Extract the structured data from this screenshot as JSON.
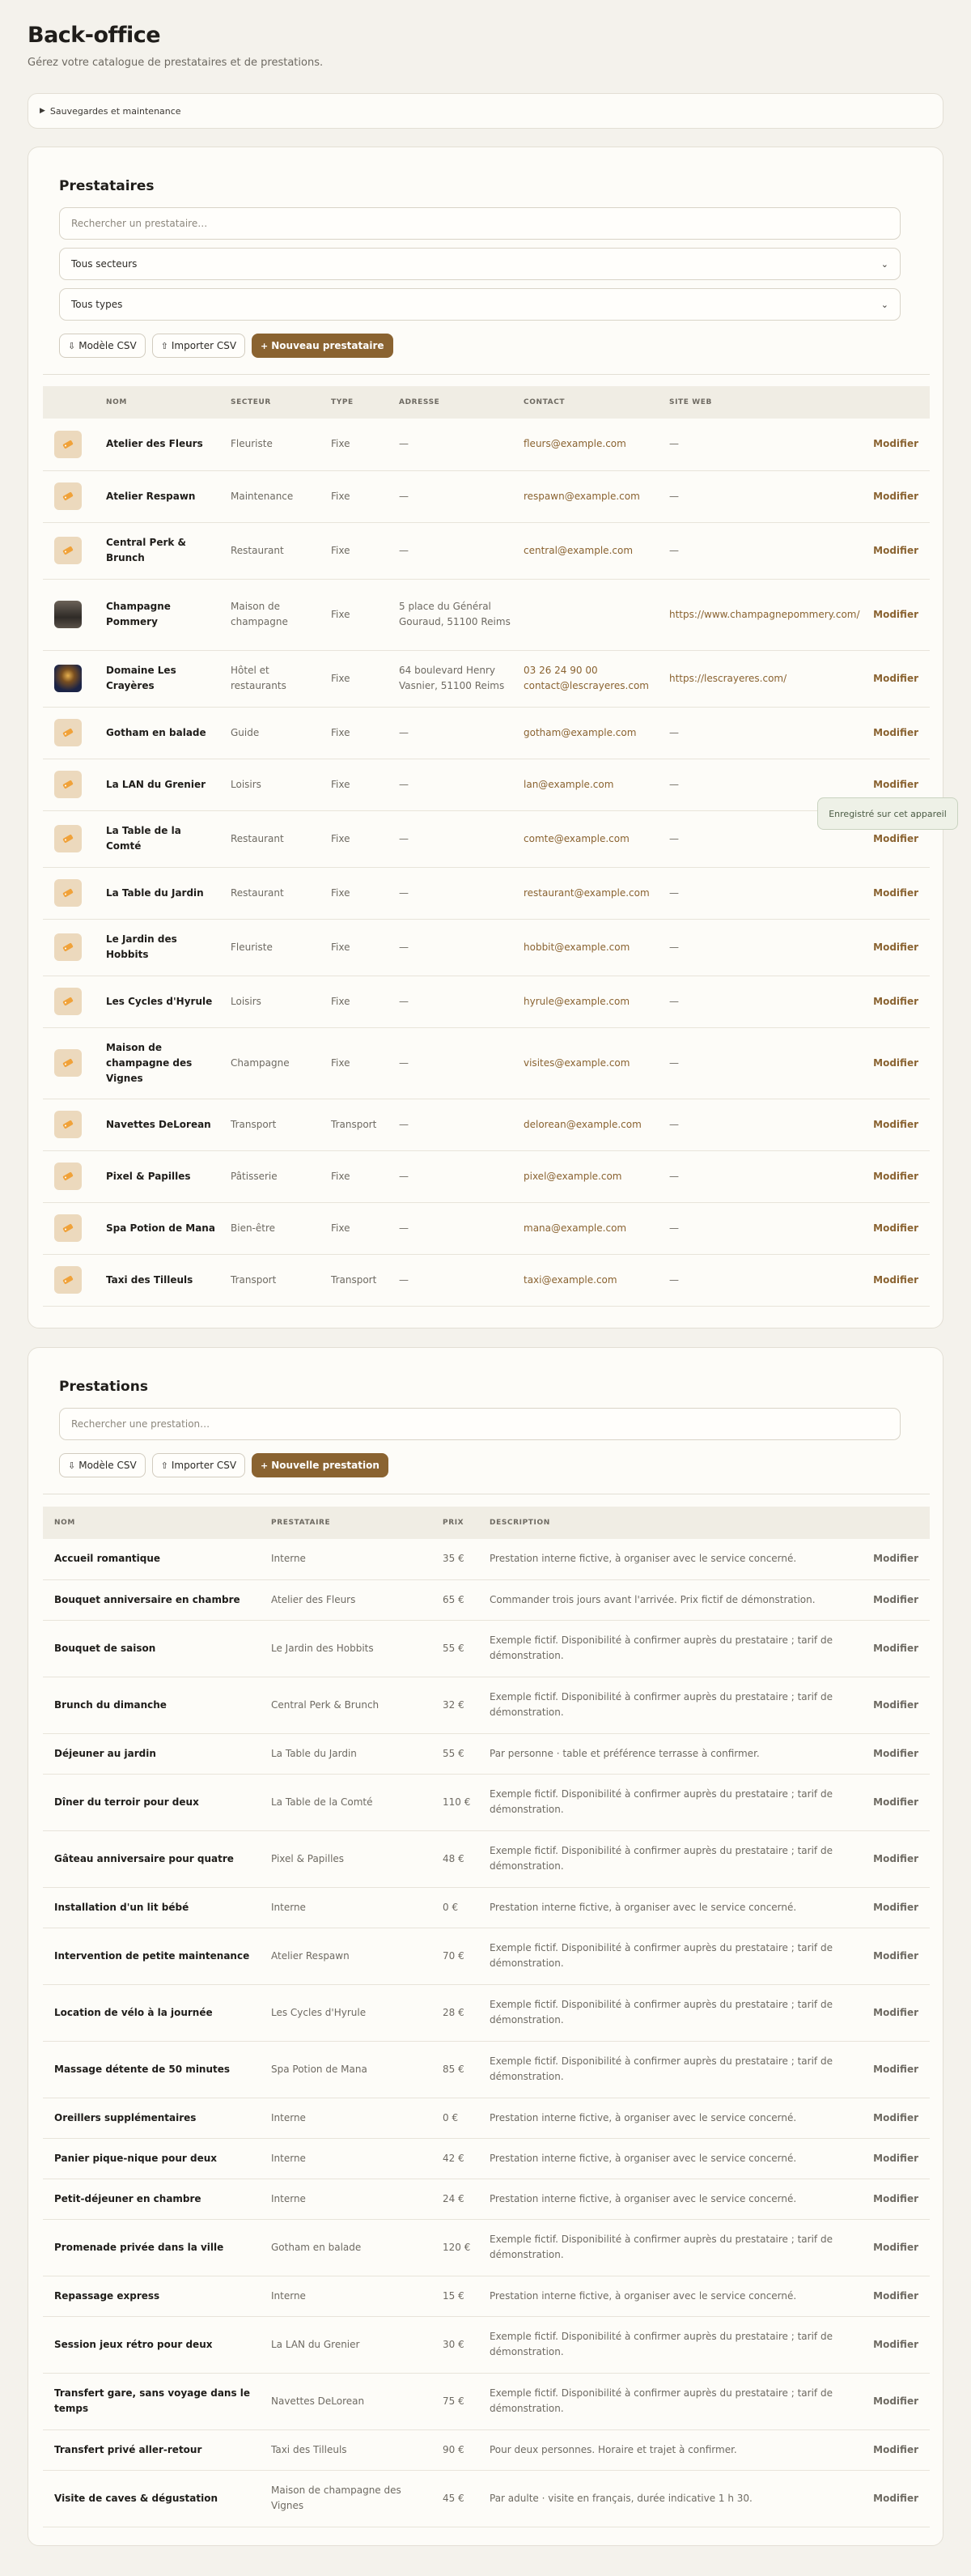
{
  "header": {
    "title": "Back-office",
    "subtitle": "Gérez votre catalogue de prestataires et de prestations."
  },
  "maintenance": {
    "label": "Sauvegardes et maintenance"
  },
  "prestataires": {
    "title": "Prestataires",
    "search_placeholder": "Rechercher un prestataire…",
    "filter_sector": "Tous secteurs",
    "filter_type": "Tous types",
    "btn_template": "Modèle CSV",
    "btn_import": "Importer CSV",
    "btn_new": "Nouveau prestataire",
    "columns": [
      "",
      "NOM",
      "SECTEUR",
      "TYPE",
      "ADRESSE",
      "CONTACT",
      "SITE WEB",
      ""
    ],
    "action_label": "Modifier",
    "rows": [
      {
        "name": "Atelier des Fleurs",
        "sector": "Fleuriste",
        "type": "Fixe",
        "address": "—",
        "contact": "fleurs@example.com",
        "web": "—",
        "thumb": "icon"
      },
      {
        "name": "Atelier Respawn",
        "sector": "Maintenance",
        "type": "Fixe",
        "address": "—",
        "contact": "respawn@example.com",
        "web": "—",
        "thumb": "icon"
      },
      {
        "name": "Central Perk & Brunch",
        "sector": "Restaurant",
        "type": "Fixe",
        "address": "—",
        "contact": "central@example.com",
        "web": "—",
        "thumb": "icon"
      },
      {
        "name": "Champagne Pommery",
        "sector": "Maison de champagne",
        "type": "Fixe",
        "address": "5 place du Général Gouraud, 51100 Reims",
        "contact": "",
        "web": "https://www.champagnepommery.com/",
        "thumb": "photo1"
      },
      {
        "name": "Domaine Les Crayères",
        "sector": "Hôtel et restaurants",
        "type": "Fixe",
        "address": "64 boulevard Henry Vasnier, 51100 Reims",
        "contact": "03 26 24 90 00\ncontact@lescrayeres.com",
        "web": "https://lescrayeres.com/",
        "thumb": "photo2"
      },
      {
        "name": "Gotham en balade",
        "sector": "Guide",
        "type": "Fixe",
        "address": "—",
        "contact": "gotham@example.com",
        "web": "—",
        "thumb": "icon"
      },
      {
        "name": "La LAN du Grenier",
        "sector": "Loisirs",
        "type": "Fixe",
        "address": "—",
        "contact": "lan@example.com",
        "web": "—",
        "thumb": "icon"
      },
      {
        "name": "La Table de la Comté",
        "sector": "Restaurant",
        "type": "Fixe",
        "address": "—",
        "contact": "comte@example.com",
        "web": "—",
        "thumb": "icon"
      },
      {
        "name": "La Table du Jardin",
        "sector": "Restaurant",
        "type": "Fixe",
        "address": "—",
        "contact": "restaurant@example.com",
        "web": "—",
        "thumb": "icon"
      },
      {
        "name": "Le Jardin des Hobbits",
        "sector": "Fleuriste",
        "type": "Fixe",
        "address": "—",
        "contact": "hobbit@example.com",
        "web": "—",
        "thumb": "icon"
      },
      {
        "name": "Les Cycles d'Hyrule",
        "sector": "Loisirs",
        "type": "Fixe",
        "address": "—",
        "contact": "hyrule@example.com",
        "web": "—",
        "thumb": "icon"
      },
      {
        "name": "Maison de champagne des Vignes",
        "sector": "Champagne",
        "type": "Fixe",
        "address": "—",
        "contact": "visites@example.com",
        "web": "—",
        "thumb": "icon"
      },
      {
        "name": "Navettes DeLorean",
        "sector": "Transport",
        "type": "Transport",
        "address": "—",
        "contact": "delorean@example.com",
        "web": "—",
        "thumb": "icon"
      },
      {
        "name": "Pixel & Papilles",
        "sector": "Pâtisserie",
        "type": "Fixe",
        "address": "—",
        "contact": "pixel@example.com",
        "web": "—",
        "thumb": "icon"
      },
      {
        "name": "Spa Potion de Mana",
        "sector": "Bien-être",
        "type": "Fixe",
        "address": "—",
        "contact": "mana@example.com",
        "web": "—",
        "thumb": "icon"
      },
      {
        "name": "Taxi des Tilleuls",
        "sector": "Transport",
        "type": "Transport",
        "address": "—",
        "contact": "taxi@example.com",
        "web": "—",
        "thumb": "icon"
      }
    ]
  },
  "toast": "Enregistré sur cet appareil",
  "prestations": {
    "title": "Prestations",
    "search_placeholder": "Rechercher une prestation…",
    "btn_template": "Modèle CSV",
    "btn_import": "Importer CSV",
    "btn_new": "Nouvelle prestation",
    "columns": [
      "NOM",
      "PRESTATAIRE",
      "PRIX",
      "DESCRIPTION",
      ""
    ],
    "action_label": "Modifier",
    "rows": [
      {
        "name": "Accueil romantique",
        "provider": "Interne",
        "price": "35 €",
        "desc": "Prestation interne fictive, à organiser avec le service concerné."
      },
      {
        "name": "Bouquet anniversaire en chambre",
        "provider": "Atelier des Fleurs",
        "price": "65 €",
        "desc": "Commander trois jours avant l'arrivée. Prix fictif de démonstration."
      },
      {
        "name": "Bouquet de saison",
        "provider": "Le Jardin des Hobbits",
        "price": "55 €",
        "desc": "Exemple fictif. Disponibilité à confirmer auprès du prestataire ; tarif de démonstration."
      },
      {
        "name": "Brunch du dimanche",
        "provider": "Central Perk & Brunch",
        "price": "32 €",
        "desc": "Exemple fictif. Disponibilité à confirmer auprès du prestataire ; tarif de démonstration."
      },
      {
        "name": "Déjeuner au jardin",
        "provider": "La Table du Jardin",
        "price": "55 €",
        "desc": "Par personne · table et préférence terrasse à confirmer."
      },
      {
        "name": "Dîner du terroir pour deux",
        "provider": "La Table de la Comté",
        "price": "110 €",
        "desc": "Exemple fictif. Disponibilité à confirmer auprès du prestataire ; tarif de démonstration."
      },
      {
        "name": "Gâteau anniversaire pour quatre",
        "provider": "Pixel & Papilles",
        "price": "48 €",
        "desc": "Exemple fictif. Disponibilité à confirmer auprès du prestataire ; tarif de démonstration."
      },
      {
        "name": "Installation d'un lit bébé",
        "provider": "Interne",
        "price": "0 €",
        "desc": "Prestation interne fictive, à organiser avec le service concerné."
      },
      {
        "name": "Intervention de petite maintenance",
        "provider": "Atelier Respawn",
        "price": "70 €",
        "desc": "Exemple fictif. Disponibilité à confirmer auprès du prestataire ; tarif de démonstration."
      },
      {
        "name": "Location de vélo à la journée",
        "provider": "Les Cycles d'Hyrule",
        "price": "28 €",
        "desc": "Exemple fictif. Disponibilité à confirmer auprès du prestataire ; tarif de démonstration."
      },
      {
        "name": "Massage détente de 50 minutes",
        "provider": "Spa Potion de Mana",
        "price": "85 €",
        "desc": "Exemple fictif. Disponibilité à confirmer auprès du prestataire ; tarif de démonstration."
      },
      {
        "name": "Oreillers supplémentaires",
        "provider": "Interne",
        "price": "0 €",
        "desc": "Prestation interne fictive, à organiser avec le service concerné."
      },
      {
        "name": "Panier pique-nique pour deux",
        "provider": "Interne",
        "price": "42 €",
        "desc": "Prestation interne fictive, à organiser avec le service concerné."
      },
      {
        "name": "Petit-déjeuner en chambre",
        "provider": "Interne",
        "price": "24 €",
        "desc": "Prestation interne fictive, à organiser avec le service concerné."
      },
      {
        "name": "Promenade privée dans la ville",
        "provider": "Gotham en balade",
        "price": "120 €",
        "desc": "Exemple fictif. Disponibilité à confirmer auprès du prestataire ; tarif de démonstration."
      },
      {
        "name": "Repassage express",
        "provider": "Interne",
        "price": "15 €",
        "desc": "Prestation interne fictive, à organiser avec le service concerné."
      },
      {
        "name": "Session jeux rétro pour deux",
        "provider": "La LAN du Grenier",
        "price": "30 €",
        "desc": "Exemple fictif. Disponibilité à confirmer auprès du prestataire ; tarif de démonstration."
      },
      {
        "name": "Transfert gare, sans voyage dans le temps",
        "provider": "Navettes DeLorean",
        "price": "75 €",
        "desc": "Exemple fictif. Disponibilité à confirmer auprès du prestataire ; tarif de démonstration."
      },
      {
        "name": "Transfert privé aller-retour",
        "provider": "Taxi des Tilleuls",
        "price": "90 €",
        "desc": "Pour deux personnes. Horaire et trajet à confirmer."
      },
      {
        "name": "Visite de caves & dégustation",
        "provider": "Maison de champagne des Vignes",
        "price": "45 €",
        "desc": "Par adulte · visite en français, durée indicative 1 h 30."
      }
    ]
  }
}
